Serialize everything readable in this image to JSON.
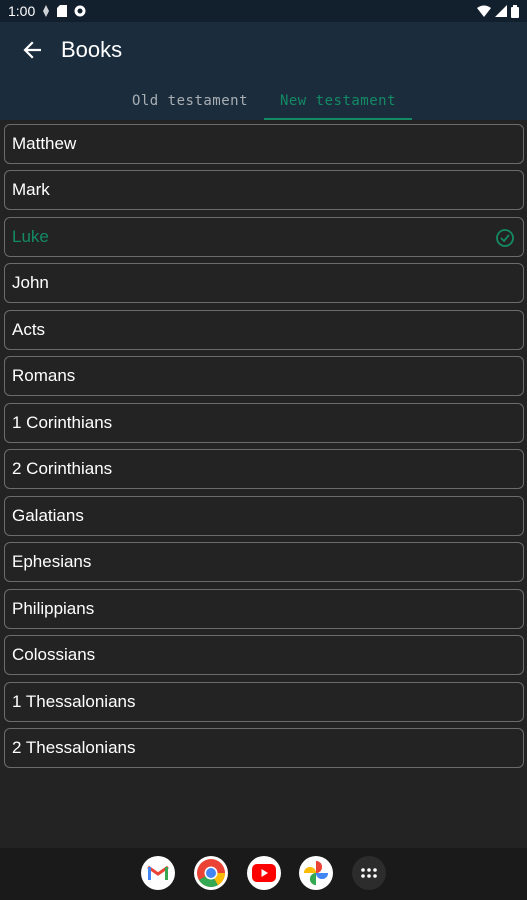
{
  "status_bar": {
    "time": "1:00"
  },
  "header": {
    "title": "Books"
  },
  "tabs": [
    {
      "label": "Old testament"
    },
    {
      "label": "New testament"
    }
  ],
  "books": [
    {
      "name": "Matthew"
    },
    {
      "name": "Mark"
    },
    {
      "name": "Luke"
    },
    {
      "name": "John"
    },
    {
      "name": "Acts"
    },
    {
      "name": "Romans"
    },
    {
      "name": "1 Corinthians"
    },
    {
      "name": "2 Corinthians"
    },
    {
      "name": "Galatians"
    },
    {
      "name": "Ephesians"
    },
    {
      "name": "Philippians"
    },
    {
      "name": "Colossians"
    },
    {
      "name": "1 Thessalonians"
    },
    {
      "name": "2 Thessalonians"
    }
  ],
  "selected_book": "Luke",
  "colors": {
    "accent": "#138a64",
    "background": "#232323",
    "app_bar": "#1b2d3d"
  },
  "dock": {
    "apps": [
      "gmail-icon",
      "chrome-icon",
      "youtube-icon",
      "photos-icon",
      "app-drawer-icon"
    ]
  }
}
